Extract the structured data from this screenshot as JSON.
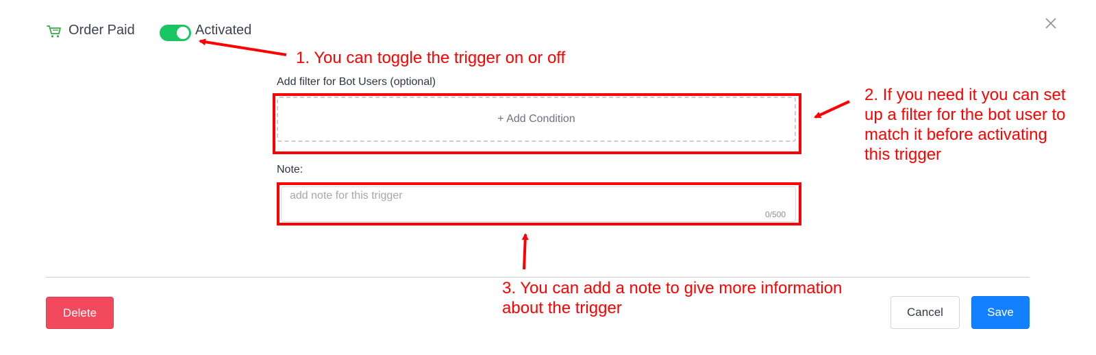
{
  "header": {
    "trigger_title": "Order Paid",
    "trigger_icon": "shopping-cart-icon",
    "toggle": {
      "state": "on",
      "label": "Activated"
    },
    "close_icon": "close-icon"
  },
  "form": {
    "filter_label": "Add filter for Bot Users (optional)",
    "add_condition_label": "+ Add Condition",
    "note_label": "Note:",
    "note_value": "",
    "note_placeholder": "add note for this trigger",
    "note_counter": "0/500"
  },
  "annotations": {
    "step1": "1. You can toggle the trigger on or off",
    "step2": "2. If you need it you can set up a filter for the bot user to match it before activating this trigger",
    "step3": "3. You can add a note to give more information about the trigger"
  },
  "footer": {
    "delete_label": "Delete",
    "cancel_label": "Cancel",
    "save_label": "Save"
  },
  "colors": {
    "toggle_on": "#19c463",
    "delete": "#f2495c",
    "save": "#1380ff",
    "annotation": "#ff0000",
    "cart_icon": "#3aa84a"
  }
}
